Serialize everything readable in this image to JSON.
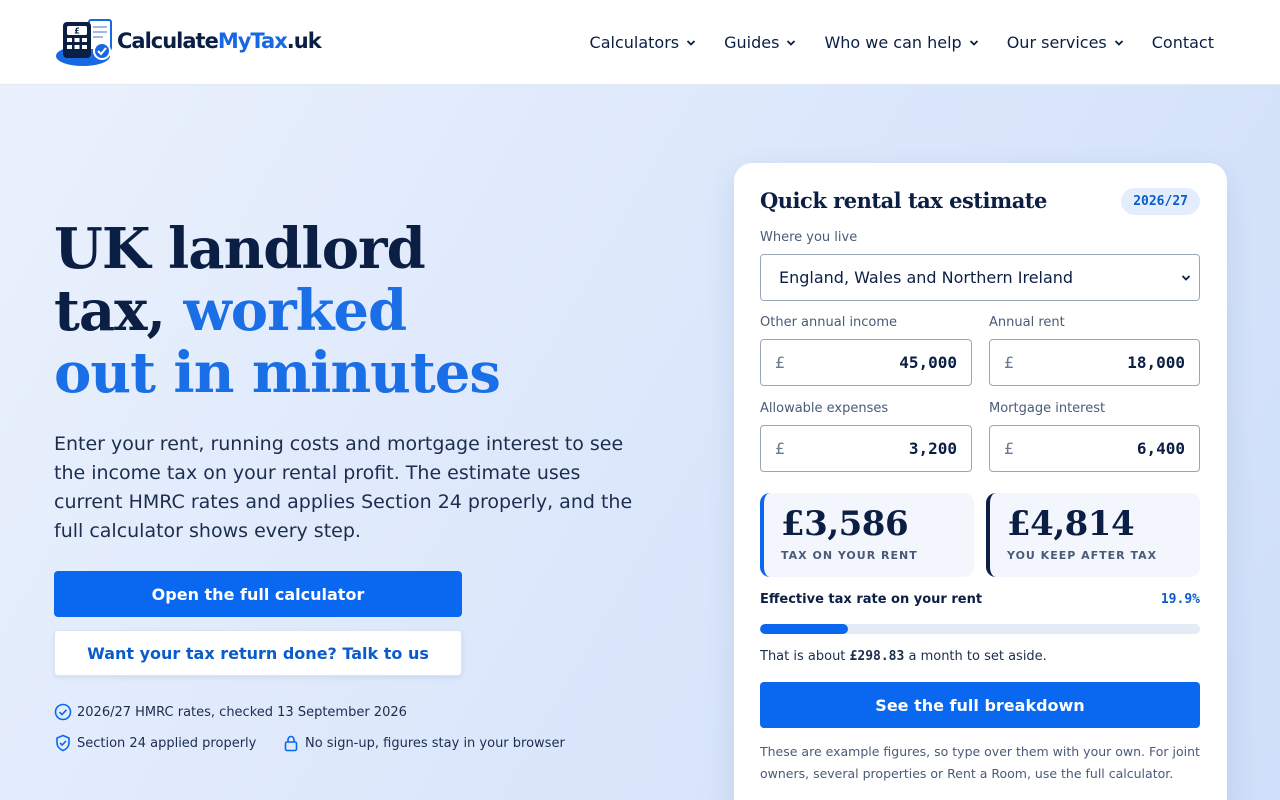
{
  "header": {
    "logo": {
      "part1": "Calculate",
      "part2": "MyTax",
      "part3": ".uk",
      "icon": "calculator-document-check-icon"
    },
    "nav": [
      {
        "label": "Calculators",
        "has_dropdown": true
      },
      {
        "label": "Guides",
        "has_dropdown": true
      },
      {
        "label": "Who we can help",
        "has_dropdown": true
      },
      {
        "label": "Our services",
        "has_dropdown": true
      },
      {
        "label": "Contact",
        "has_dropdown": false
      }
    ]
  },
  "hero": {
    "headline_line1": "UK landlord",
    "headline_line2a": "tax, ",
    "headline_line2b": "worked",
    "headline_line3": "out in minutes",
    "lede": "Enter your rent, running costs and mortgage interest to see the income tax on your rental profit. The estimate uses current HMRC rates and applies Section 24 properly, and the full calculator shows every step.",
    "primary_cta": "Open the full calculator",
    "secondary_cta": "Want your tax return done? Talk to us",
    "trust": [
      {
        "icon": "check-circle-icon",
        "text": "2026/27 HMRC rates, checked 13 September 2026"
      },
      {
        "icon": "shield-check-icon",
        "text": "Section 24 applied properly"
      },
      {
        "icon": "lock-icon",
        "text": "No sign-up, figures stay in your browser"
      }
    ]
  },
  "estimate": {
    "title": "Quick rental tax estimate",
    "tax_year": "2026/27",
    "location_label": "Where you live",
    "location_value": "England, Wales and Northern Ireland",
    "other_income_label": "Other annual income",
    "other_income_value": "45,000",
    "annual_rent_label": "Annual rent",
    "annual_rent_value": "18,000",
    "expenses_label": "Allowable expenses",
    "expenses_value": "3,200",
    "mortgage_label": "Mortgage interest",
    "mortgage_value": "6,400",
    "currency_symbol": "£",
    "tax_amount": "£3,586",
    "tax_caption": "TAX ON YOUR RENT",
    "keep_amount": "£4,814",
    "keep_caption": "YOU KEEP AFTER TAX",
    "rate_label": "Effective tax rate on your rent",
    "rate_value": "19.9%",
    "rate_fraction": 0.199,
    "aside_prefix": "That is about ",
    "aside_amount": "£298.83",
    "aside_suffix": " a month to set aside.",
    "cta": "See the full breakdown",
    "footnote": "These are example figures, so type over them with your own. For joint owners, several properties or Rent a Room, use the full calculator."
  },
  "colors": {
    "brand_blue": "#0a68f0",
    "navy": "#0b1f44",
    "accent_text": "#1a6fe6"
  }
}
